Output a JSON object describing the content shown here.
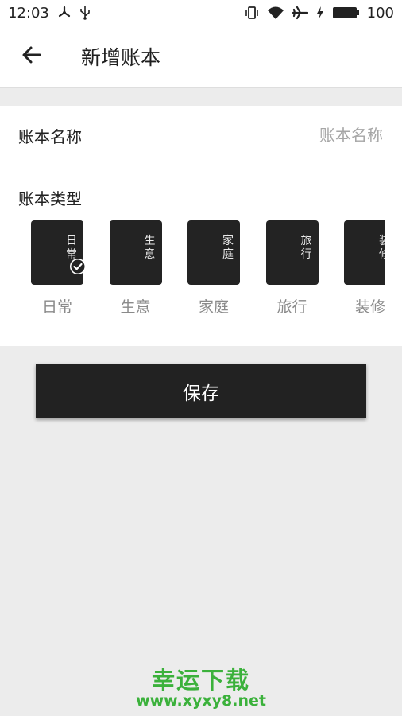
{
  "status_bar": {
    "time": "12:03",
    "battery": "100",
    "icons": [
      "fan-icon",
      "usb-icon",
      "vibrate-icon",
      "wifi-icon",
      "airplane-icon",
      "charging-icon",
      "battery-icon"
    ]
  },
  "header": {
    "title": "新增账本",
    "back_icon": "arrow-left-icon"
  },
  "form": {
    "name_label": "账本名称",
    "name_value": "",
    "name_placeholder": "账本名称",
    "type_label": "账本类型",
    "types": [
      {
        "label": "日常",
        "cover_text": "日常",
        "selected": true
      },
      {
        "label": "生意",
        "cover_text": "生意",
        "selected": false
      },
      {
        "label": "家庭",
        "cover_text": "家庭",
        "selected": false
      },
      {
        "label": "旅行",
        "cover_text": "旅行",
        "selected": false
      },
      {
        "label": "装修",
        "cover_text": "装修",
        "selected": false
      }
    ]
  },
  "save_button": {
    "label": "保存"
  },
  "watermark": {
    "title": "幸运下载",
    "url": "www.xyxy8.net"
  },
  "colors": {
    "accent_dark": "#222222",
    "watermark_green": "#3bb13b",
    "background": "#ececec"
  }
}
